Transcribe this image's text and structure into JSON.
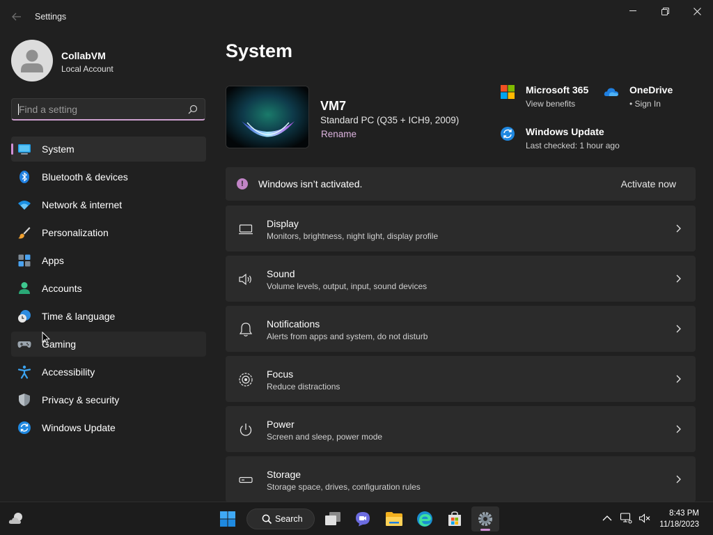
{
  "window": {
    "title": "Settings",
    "back_icon": "arrow-left-icon",
    "controls": [
      "minimize-icon",
      "restore-icon",
      "close-icon"
    ]
  },
  "user": {
    "name": "CollabVM",
    "account_type": "Local Account"
  },
  "search": {
    "placeholder": "Find a setting",
    "value": ""
  },
  "sidebar": {
    "items": [
      {
        "label": "System",
        "icon": "system-icon",
        "state": "selected"
      },
      {
        "label": "Bluetooth & devices",
        "icon": "bluetooth-icon"
      },
      {
        "label": "Network & internet",
        "icon": "wifi-icon"
      },
      {
        "label": "Personalization",
        "icon": "brush-icon"
      },
      {
        "label": "Apps",
        "icon": "apps-icon"
      },
      {
        "label": "Accounts",
        "icon": "person-icon"
      },
      {
        "label": "Time & language",
        "icon": "clock-globe-icon"
      },
      {
        "label": "Gaming",
        "icon": "controller-icon",
        "state": "hover"
      },
      {
        "label": "Accessibility",
        "icon": "accessibility-icon"
      },
      {
        "label": "Privacy & security",
        "icon": "shield-icon"
      },
      {
        "label": "Windows Update",
        "icon": "update-icon"
      }
    ]
  },
  "main": {
    "title": "System",
    "device": {
      "name": "VM7",
      "model": "Standard PC (Q35 + ICH9, 2009)",
      "rename_label": "Rename"
    },
    "quick_links": {
      "m365": {
        "title": "Microsoft 365",
        "subtitle": "View benefits",
        "icon": "microsoft-logo-icon"
      },
      "onedrive": {
        "title": "OneDrive",
        "subtitle": "• Sign In",
        "icon": "cloud-icon"
      },
      "update": {
        "title": "Windows Update",
        "subtitle": "Last checked: 1 hour ago",
        "icon": "update-icon"
      }
    },
    "activation": {
      "message": "Windows isn’t activated.",
      "action": "Activate now",
      "icon": "info-icon",
      "icon_glyph": "!"
    },
    "cards": [
      {
        "title": "Display",
        "subtitle": "Monitors, brightness, night light, display profile",
        "icon": "monitor-icon"
      },
      {
        "title": "Sound",
        "subtitle": "Volume levels, output, input, sound devices",
        "icon": "speaker-icon"
      },
      {
        "title": "Notifications",
        "subtitle": "Alerts from apps and system, do not disturb",
        "icon": "bell-icon"
      },
      {
        "title": "Focus",
        "subtitle": "Reduce distractions",
        "icon": "focus-icon"
      },
      {
        "title": "Power",
        "subtitle": "Screen and sleep, power mode",
        "icon": "power-icon"
      },
      {
        "title": "Storage",
        "subtitle": "Storage space, drives, configuration rules",
        "icon": "drive-icon"
      }
    ]
  },
  "taskbar": {
    "search_label": "Search",
    "pinned": [
      "start-icon",
      "task-view-icon",
      "chat-icon",
      "file-explorer-icon",
      "edge-icon",
      "store-icon",
      "settings-icon"
    ],
    "active_app": "settings-icon",
    "tray": [
      "chevron-up-icon",
      "network-icon",
      "volume-muted-icon"
    ],
    "time": "8:43 PM",
    "date": "11/18/2023",
    "widgets_icon": "weather-icon"
  },
  "colors": {
    "accent": "#d08fd5",
    "background": "#202020",
    "card": "#2b2b2b",
    "link": "#dcb3de"
  }
}
